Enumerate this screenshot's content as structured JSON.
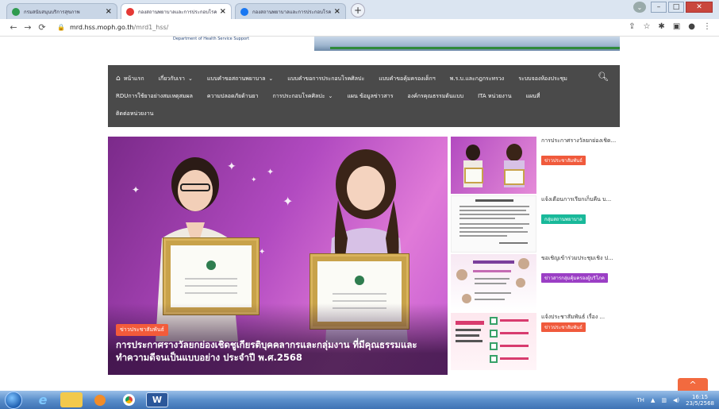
{
  "browser": {
    "tabs": [
      {
        "title": "กรมสนับสนุนบริการสุขภาพ",
        "favicon_color": "#2e9b4f",
        "active": false
      },
      {
        "title": "กองสถานพยาบาลและการประกอบโรคศิ",
        "favicon_color": "#e53935",
        "active": true
      },
      {
        "title": "กองสถานพยาบาลและการประกอบโรคศิ",
        "favicon_color": "#1877f2",
        "active": false
      }
    ],
    "new_tab": "+",
    "url_host": "mrd.hss.moph.go.th",
    "url_path": "/mrd1_hss/"
  },
  "banner": {
    "department": "Department of Health Service Support"
  },
  "menu": {
    "row1": [
      {
        "label": "หน้าแรก",
        "has_dropdown": false
      },
      {
        "label": "เกี่ยวกับเรา",
        "has_dropdown": true
      },
      {
        "label": "แบบคำขอสถานพยาบาล",
        "has_dropdown": true
      },
      {
        "label": "แบบคำขอการประกอบโรคศิลปะ",
        "has_dropdown": false
      },
      {
        "label": "แบบคำขอคุ้มครองเด็กฯ",
        "has_dropdown": false
      },
      {
        "label": "พ.ร.บ.และกฎกระทรวง",
        "has_dropdown": false
      },
      {
        "label": "ระบบจองห้องประชุม",
        "has_dropdown": false
      }
    ],
    "row2": [
      {
        "label": "RDUการใช้ยาอย่างสมเหตุสมผล",
        "has_dropdown": false
      },
      {
        "label": "ความปลอดภัยด้านยา",
        "has_dropdown": false
      },
      {
        "label": "การประกอบโรคศิลปะ",
        "has_dropdown": true
      },
      {
        "label": "แผน ข้อมูลข่าวสาร",
        "has_dropdown": false
      },
      {
        "label": "องค์กรคุณธรรมต้นแบบ",
        "has_dropdown": false
      },
      {
        "label": "ITA หน่วยงาน",
        "has_dropdown": false
      },
      {
        "label": "แผนที่",
        "has_dropdown": false
      }
    ],
    "row3": [
      {
        "label": "ติดต่อหน่วยงาน",
        "has_dropdown": false
      }
    ]
  },
  "hero": {
    "category": "ข่าวประชาสัมพันธ์",
    "headline": "การประกาศรางวัลยกย่องเชิดชูเกียรติบุคคลากรและกลุ่มงาน ที่มีคุณธรรมและทำความดีจนเป็นแบบอย่าง ประจำปี พ.ศ.2568"
  },
  "side_news": [
    {
      "title": "การประกาศรางวัลยกย่องเชิด...",
      "category": "ข่าวประชาสัมพันธ์",
      "category_color": "#f05a3c"
    },
    {
      "title": "แจ้งเตือนการเรียกเก็บคืน บ...",
      "category": "กลุ่มสถานพยาบาล",
      "category_color": "#19b99a"
    },
    {
      "title": "ขอเชิญเข้าร่วมประชุมเชิง ป...",
      "category": "ข่าวสารกลุ่มคุ้มครองผู้บริโภค",
      "category_color": "#9b3fc5"
    },
    {
      "title": "แจ้งประชาสัมพันธ์ เรื่อง ...",
      "category": "ข่าวประชาสัมพันธ์",
      "category_color": "#f05a3c"
    }
  ],
  "scroll_top": "^",
  "taskbar": {
    "word_app": "W",
    "language": "TH",
    "time": "16:15",
    "date": "23/5/2568"
  }
}
